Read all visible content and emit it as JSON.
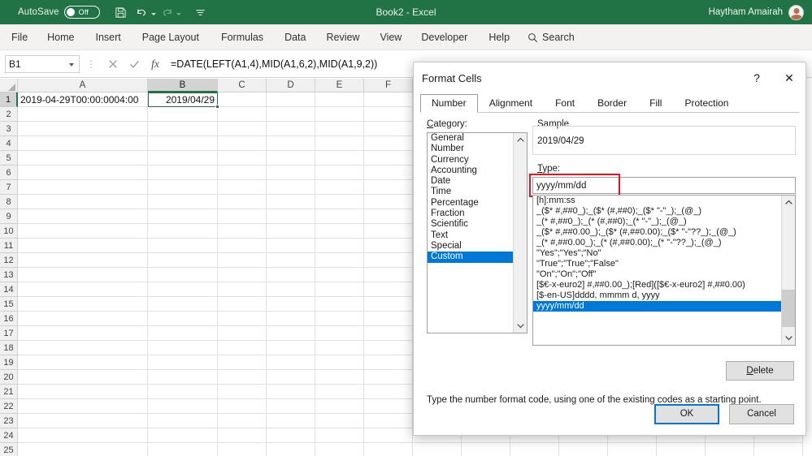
{
  "titlebar": {
    "autosave_label": "AutoSave",
    "autosave_state": "Off",
    "doc_title": "Book2  -  Excel",
    "user_name": "Haytham Amairah"
  },
  "ribbon": {
    "tabs": [
      "File",
      "Home",
      "Insert",
      "Page Layout",
      "Formulas",
      "Data",
      "Review",
      "View",
      "Developer",
      "Help"
    ],
    "search_label": "Search"
  },
  "formulabar": {
    "namebox_value": "B1",
    "formula": "=DATE(LEFT(A1,4),MID(A1,6,2),MID(A1,9,2))"
  },
  "grid": {
    "columns": [
      "A",
      "B",
      "C",
      "D",
      "E",
      "F"
    ],
    "selected_column": "B",
    "selected_row": 1,
    "rows": [
      1,
      2,
      3,
      4,
      5,
      6,
      7,
      8,
      9,
      10,
      11,
      12,
      13,
      14,
      15,
      16,
      17,
      18,
      19,
      20,
      21,
      22,
      23,
      24,
      25
    ],
    "cell_a1": "2019-04-29T00:00:0004:00",
    "cell_b1": "2019/04/29"
  },
  "dialog": {
    "title": "Format Cells",
    "help_glyph": "?",
    "close_glyph": "✕",
    "tabs": [
      "Number",
      "Alignment",
      "Font",
      "Border",
      "Fill",
      "Protection"
    ],
    "active_tab": "Number",
    "category_label": "Category:",
    "categories": [
      "General",
      "Number",
      "Currency",
      "Accounting",
      "Date",
      "Time",
      "Percentage",
      "Fraction",
      "Scientific",
      "Text",
      "Special",
      "Custom"
    ],
    "selected_category": "Custom",
    "sample_label": "Sample",
    "sample_value": "2019/04/29",
    "type_label": "Type:",
    "type_value": "yyyy/mm/dd",
    "format_codes": [
      "[h]:mm:ss",
      "_($* #,##0_);_($* (#,##0);_($* \"-\"_);_(@_)",
      "_(* #,##0_);_(* (#,##0);_(* \"-\"_);_(@_)",
      "_($* #,##0.00_);_($* (#,##0.00);_($* \"-\"??_);_(@_)",
      "_(* #,##0.00_);_(* (#,##0.00);_(* \"-\"??_);_(@_)",
      "\"Yes\";\"Yes\";\"No\"",
      "\"True\";\"True\";\"False\"",
      "\"On\";\"On\";\"Off\"",
      "[$€-x-euro2] #,##0.00_);[Red]([$€-x-euro2] #,##0.00)",
      "[$-en-US]dddd, mmmm d, yyyy",
      "yyyy/mm/dd"
    ],
    "selected_format_code": "yyyy/mm/dd",
    "delete_label": "Delete",
    "hint": "Type the number format code, using one of the existing codes as a starting point.",
    "ok_label": "OK",
    "cancel_label": "Cancel"
  },
  "colors": {
    "excel_green": "#217346",
    "selection_blue": "#0078d7",
    "annotation_red": "#e81123"
  }
}
